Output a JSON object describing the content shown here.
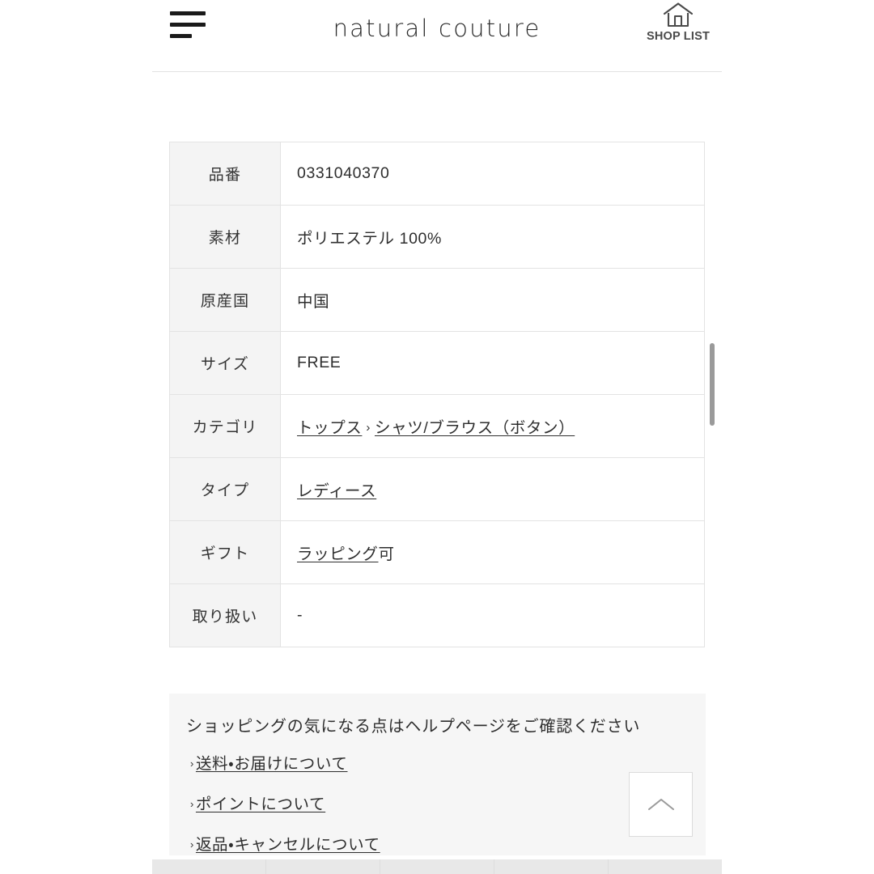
{
  "header": {
    "menu_icon": "hamburger-menu-icon",
    "logo": "natural couture",
    "shop_list_label": "SHOP LIST",
    "shop_list_icon": "home-icon"
  },
  "spec_table": {
    "rows": [
      {
        "label": "品番",
        "value": "0331040370",
        "type": "text"
      },
      {
        "label": "素材",
        "value": "ポリエステル 100%",
        "type": "text"
      },
      {
        "label": "原産国",
        "value": "中国",
        "type": "text"
      },
      {
        "label": "サイズ",
        "value": "FREE",
        "type": "text"
      },
      {
        "label": "カテゴリ",
        "type": "breadcrumb",
        "link1": "トップス",
        "separator": "›",
        "link2": "シャツ/ブラウス（ボタン）"
      },
      {
        "label": "タイプ",
        "value": "レディース",
        "type": "link"
      },
      {
        "label": "ギフト",
        "type": "link_plus_text",
        "link": "ラッピング",
        "suffix": "可"
      },
      {
        "label": "取り扱い",
        "value": "-",
        "type": "text"
      }
    ]
  },
  "help": {
    "title": "ショッピングの気になる点はヘルプページをご確認ください",
    "chevron": "›",
    "links": [
      "送料・お届けについて",
      "ポイントについて",
      "返品・キャンセルについて"
    ]
  },
  "scroll_top": {
    "icon": "chevron-up-icon"
  },
  "bottom_nav": {
    "cells": [
      "",
      "",
      "",
      "",
      ""
    ]
  },
  "colors": {
    "page_bg": "#ffffff",
    "table_header_bg": "#f4f4f4",
    "table_border": "#e3e3e3",
    "help_bg": "#f6f6f6",
    "text": "#2e2e2e",
    "scrollbar": "#9a9a9a",
    "bottom_nav_bg": "#e8e8e8"
  }
}
